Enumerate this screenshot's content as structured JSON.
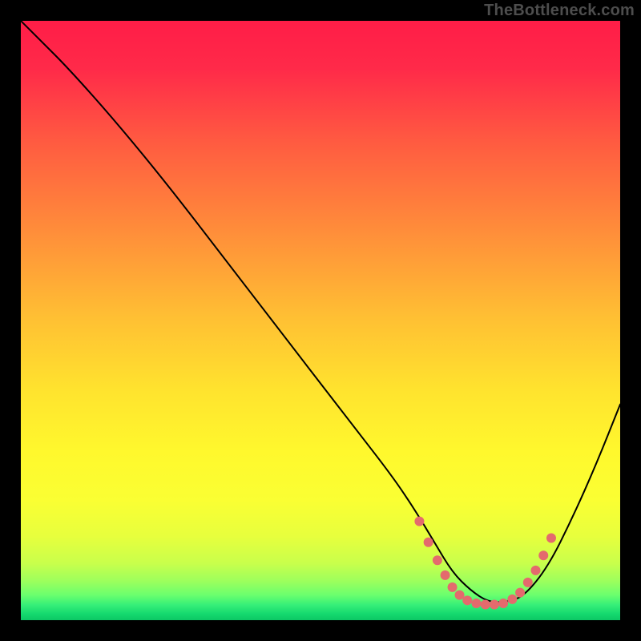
{
  "watermark": "TheBottleneck.com",
  "chart_data": {
    "type": "line",
    "title": "",
    "xlabel": "",
    "ylabel": "",
    "xlim": [
      0,
      100
    ],
    "ylim": [
      0,
      100
    ],
    "grid": false,
    "legend": false,
    "background": {
      "type": "vertical-gradient",
      "stops": [
        {
          "offset": 0.0,
          "color": "#ff1d47"
        },
        {
          "offset": 0.08,
          "color": "#ff2a49"
        },
        {
          "offset": 0.2,
          "color": "#ff5a41"
        },
        {
          "offset": 0.35,
          "color": "#ff8d3a"
        },
        {
          "offset": 0.5,
          "color": "#ffc133"
        },
        {
          "offset": 0.62,
          "color": "#ffe42e"
        },
        {
          "offset": 0.72,
          "color": "#fff82d"
        },
        {
          "offset": 0.8,
          "color": "#faff33"
        },
        {
          "offset": 0.86,
          "color": "#e7ff3d"
        },
        {
          "offset": 0.905,
          "color": "#c9ff4b"
        },
        {
          "offset": 0.935,
          "color": "#9cff5d"
        },
        {
          "offset": 0.958,
          "color": "#6bff6e"
        },
        {
          "offset": 0.975,
          "color": "#35ef78"
        },
        {
          "offset": 0.99,
          "color": "#14d86e"
        },
        {
          "offset": 1.0,
          "color": "#0cc764"
        }
      ]
    },
    "series": [
      {
        "name": "bottleneck-curve",
        "color": "#000000",
        "width": 2,
        "x": [
          0,
          3,
          8,
          16,
          25,
          35,
          45,
          55,
          62,
          66,
          69,
          72,
          75,
          78,
          81,
          84,
          88,
          92,
          96,
          100
        ],
        "values": [
          100,
          97,
          92,
          83,
          72,
          59,
          46,
          33,
          24,
          18,
          13,
          8,
          5,
          3,
          3,
          4,
          9,
          17,
          26,
          36
        ]
      }
    ],
    "markers": {
      "name": "optimal-range",
      "color": "#e46a6d",
      "size": 6,
      "points": [
        {
          "x": 66.5,
          "y": 16.5
        },
        {
          "x": 68.0,
          "y": 13.0
        },
        {
          "x": 69.5,
          "y": 10.0
        },
        {
          "x": 70.8,
          "y": 7.5
        },
        {
          "x": 72.0,
          "y": 5.5
        },
        {
          "x": 73.2,
          "y": 4.2
        },
        {
          "x": 74.5,
          "y": 3.3
        },
        {
          "x": 76.0,
          "y": 2.8
        },
        {
          "x": 77.5,
          "y": 2.6
        },
        {
          "x": 79.0,
          "y": 2.6
        },
        {
          "x": 80.5,
          "y": 2.8
        },
        {
          "x": 82.0,
          "y": 3.5
        },
        {
          "x": 83.3,
          "y": 4.6
        },
        {
          "x": 84.6,
          "y": 6.3
        },
        {
          "x": 85.9,
          "y": 8.3
        },
        {
          "x": 87.2,
          "y": 10.8
        },
        {
          "x": 88.5,
          "y": 13.7
        }
      ]
    }
  }
}
